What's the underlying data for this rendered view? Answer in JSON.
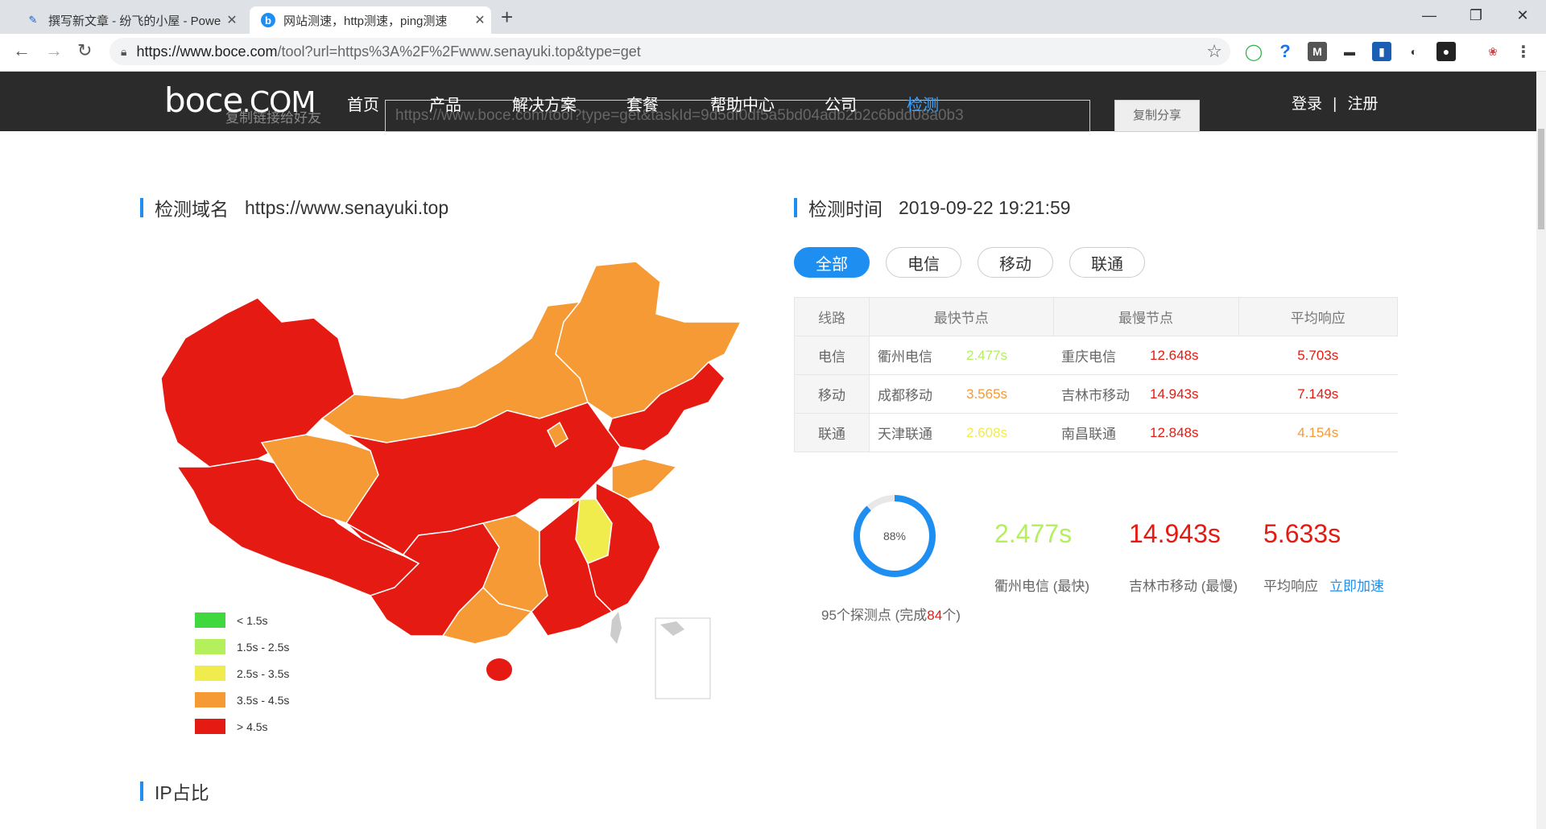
{
  "browser": {
    "tabs": [
      {
        "title": "撰写新文章 - 纷飞的小屋 - Powe"
      },
      {
        "title": "网站测速，http测速，ping测速"
      }
    ],
    "url_domain": "https://www.boce.com",
    "url_path": "/tool?url=https%3A%2F%2Fwww.senayuki.top&type=get"
  },
  "site": {
    "logo": "boce.com",
    "nav": [
      "首页",
      "产品",
      "解决方案",
      "套餐",
      "帮助中心",
      "公司",
      "检测"
    ],
    "login": "登录",
    "sep": "|",
    "register": "注册",
    "share_label": "复制链接给好友",
    "share_url": "https://www.boce.com/tool?type=get&taskId=9d5df0df5a5bd04adb2b2c6bdd08a0b3",
    "share_button": "复制分享"
  },
  "domain_section": {
    "label": "检测域名",
    "value": "https://www.senayuki.top"
  },
  "time_section": {
    "label": "检测时间",
    "value": "2019-09-22 19:21:59"
  },
  "filters": [
    "全部",
    "电信",
    "移动",
    "联通"
  ],
  "table": {
    "headers": [
      "线路",
      "最快节点",
      "最慢节点",
      "平均响应"
    ],
    "rows": [
      {
        "line": "电信",
        "fast_node": "衢州电信",
        "fast_time": "2.477s",
        "slow_node": "重庆电信",
        "slow_time": "12.648s",
        "avg": "5.703s"
      },
      {
        "line": "移动",
        "fast_node": "成都移动",
        "fast_time": "3.565s",
        "slow_node": "吉林市移动",
        "slow_time": "14.943s",
        "avg": "7.149s"
      },
      {
        "line": "联通",
        "fast_node": "天津联通",
        "fast_time": "2.608s",
        "slow_node": "南昌联通",
        "slow_time": "12.848s",
        "avg": "4.154s"
      }
    ]
  },
  "summary": {
    "progress_label": "88%",
    "progress_value": 0.88,
    "probe_prefix": "95个探测点 (完成",
    "probe_done": "84",
    "probe_suffix": "个)",
    "fastest": "2.477s",
    "fastest_label": "衢州电信 (最快)",
    "slowest": "14.943s",
    "slowest_label": "吉林市移动 (最慢)",
    "average": "5.633s",
    "average_label": "平均响应",
    "accelerate": "立即加速"
  },
  "legend": [
    {
      "label": "< 1.5s",
      "color": "#3fd93f"
    },
    {
      "label": "1.5s - 2.5s",
      "color": "#b4ef5c"
    },
    {
      "label": "2.5s - 3.5s",
      "color": "#f1ec4d"
    },
    {
      "label": "3.5s - 4.5s",
      "color": "#f59a35"
    },
    {
      "label": "> 4.5s",
      "color": "#e51a12"
    }
  ],
  "ip_section": {
    "label": "IP占比"
  },
  "colors": {
    "accent": "#1f8ef1",
    "fast": "#b4ef5c",
    "mid": "#f59a35",
    "yellow": "#f1ec4d",
    "slow": "#e51a12"
  }
}
